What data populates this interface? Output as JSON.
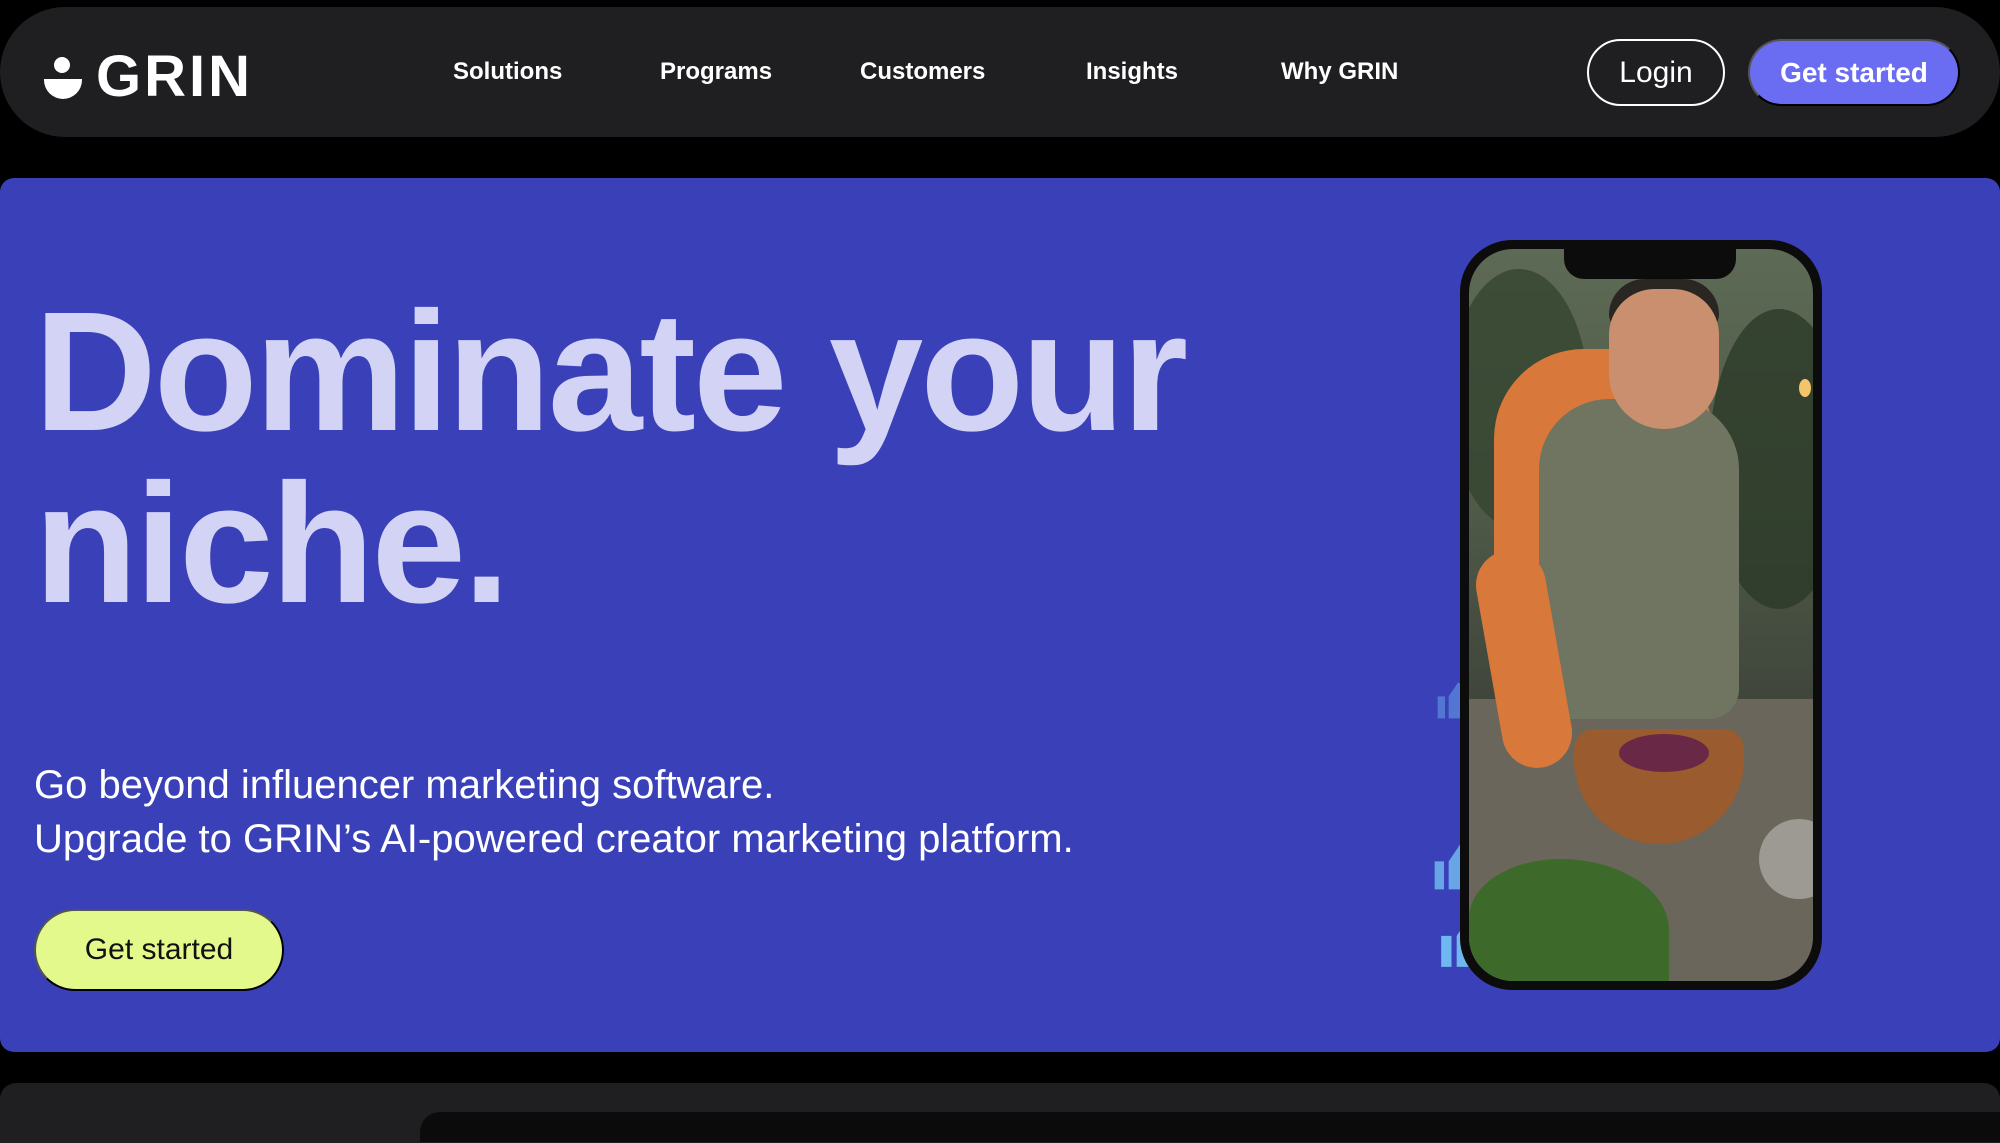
{
  "header": {
    "logo_text": "GRIN",
    "nav": [
      "Solutions",
      "Programs",
      "Customers",
      "Insights",
      "Why GRIN"
    ],
    "login_label": "Login",
    "cta_label": "Get started"
  },
  "hero": {
    "headline_line1": "Dominate your",
    "headline_line2": "niche.",
    "sub_line1": "Go beyond influencer marketing software.",
    "sub_line2": "Upgrade to GRIN’s AI-powered creator marketing platform.",
    "cta_label": "Get started"
  },
  "colors": {
    "hero_bg": "#3a41b8",
    "headline": "#d2d3f5",
    "nav_cta": "#6a6df2",
    "hero_cta": "#e3f98c",
    "thumbs": "#6fb7f0"
  }
}
